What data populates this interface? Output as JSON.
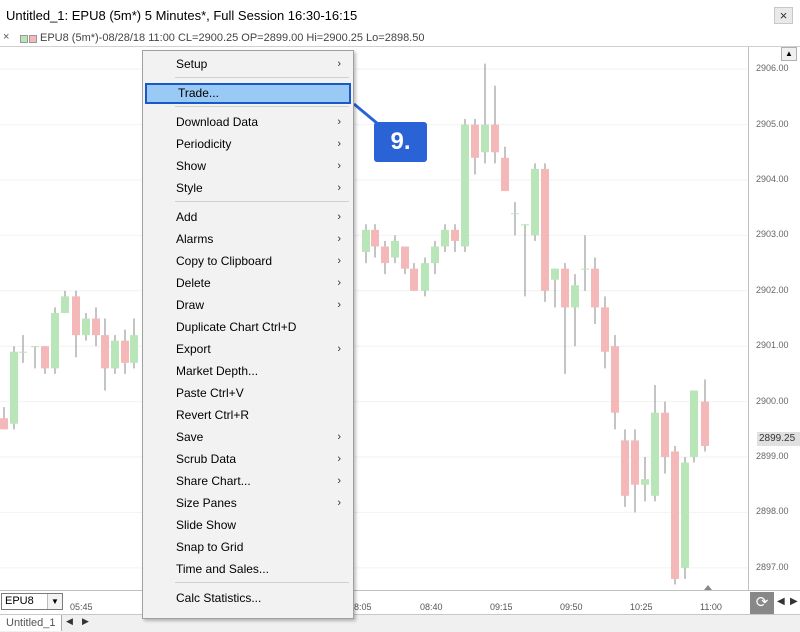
{
  "window": {
    "title": "Untitled_1: EPU8 (5m*) 5 Minutes*, Full Session 16:30-16:15",
    "close_glyph": "×"
  },
  "infobar": {
    "text": "EPU8 (5m*)-08/28/18 11:00 CL=2900.25 OP=2899.00 Hi=2900.25 Lo=2898.50",
    "close_glyph": "×"
  },
  "yaxis": {
    "ticks": [
      "2906.00",
      "2905.00",
      "2904.00",
      "2903.00",
      "2902.00",
      "2901.00",
      "2900.00",
      "2899.00",
      "2898.00",
      "2897.00"
    ],
    "current_price": "2899.25"
  },
  "xaxis": {
    "ticks": [
      "05:45",
      "8:05",
      "08:40",
      "09:15",
      "09:50",
      "10:25",
      "11:00"
    ]
  },
  "symbol": {
    "value": "EPU8"
  },
  "tab": {
    "label": "Untitled_1"
  },
  "colors": {
    "up": "#b8e6b8",
    "down": "#f4b8b8",
    "highlight": "#99c9f5",
    "callout": "#2a63d6"
  },
  "menu": {
    "items": [
      {
        "label": "Setup",
        "submenu": true
      },
      {
        "label": "Trade...",
        "submenu": false,
        "highlighted": true
      },
      {
        "label": "Download Data",
        "submenu": true
      },
      {
        "label": "Periodicity",
        "submenu": true
      },
      {
        "label": "Show",
        "submenu": true
      },
      {
        "label": "Style",
        "submenu": true
      },
      {
        "label": "Add",
        "submenu": true
      },
      {
        "label": "Alarms",
        "submenu": true
      },
      {
        "label": "Copy to Clipboard",
        "submenu": true
      },
      {
        "label": "Delete",
        "submenu": true
      },
      {
        "label": "Draw",
        "submenu": true
      },
      {
        "label": "Duplicate Chart  Ctrl+D",
        "submenu": false
      },
      {
        "label": "Export",
        "submenu": true
      },
      {
        "label": "Market Depth...",
        "submenu": false
      },
      {
        "label": "Paste  Ctrl+V",
        "submenu": false
      },
      {
        "label": "Revert  Ctrl+R",
        "submenu": false
      },
      {
        "label": "Save",
        "submenu": true
      },
      {
        "label": "Scrub Data",
        "submenu": true
      },
      {
        "label": "Share Chart...",
        "submenu": true
      },
      {
        "label": "Size Panes",
        "submenu": true
      },
      {
        "label": "Slide Show",
        "submenu": false
      },
      {
        "label": "Snap to Grid",
        "submenu": false
      },
      {
        "label": "Time and Sales...",
        "submenu": false
      },
      {
        "label": "Calc Statistics...",
        "submenu": false
      }
    ],
    "arrow_glyph": "›"
  },
  "callout": {
    "label": "9."
  },
  "chart_data": {
    "type": "candlestick",
    "ylim": [
      2896.6,
      2906.4
    ],
    "candles": [
      {
        "x": 4,
        "o": 2899.7,
        "h": 2899.9,
        "c": 2899.5,
        "l": 2899.5
      },
      {
        "x": 14,
        "o": 2899.6,
        "h": 2901.0,
        "c": 2900.9,
        "l": 2899.5
      },
      {
        "x": 23,
        "o": 2900.9,
        "h": 2901.2,
        "c": 2900.9,
        "l": 2900.7
      },
      {
        "x": 35,
        "o": 2901.0,
        "h": 2901.0,
        "c": 2901.0,
        "l": 2900.6
      },
      {
        "x": 45,
        "o": 2901.0,
        "h": 2901.0,
        "c": 2900.6,
        "l": 2900.5
      },
      {
        "x": 55,
        "o": 2900.6,
        "h": 2901.7,
        "c": 2901.6,
        "l": 2900.5
      },
      {
        "x": 65,
        "o": 2901.6,
        "h": 2902.0,
        "c": 2901.9,
        "l": 2901.6
      },
      {
        "x": 76,
        "o": 2901.9,
        "h": 2902.0,
        "c": 2901.2,
        "l": 2900.8
      },
      {
        "x": 86,
        "o": 2901.2,
        "h": 2901.6,
        "c": 2901.5,
        "l": 2901.1
      },
      {
        "x": 96,
        "o": 2901.5,
        "h": 2901.7,
        "c": 2901.2,
        "l": 2901.0
      },
      {
        "x": 105,
        "o": 2901.2,
        "h": 2901.5,
        "c": 2900.6,
        "l": 2900.2
      },
      {
        "x": 115,
        "o": 2900.6,
        "h": 2901.2,
        "c": 2901.1,
        "l": 2900.5
      },
      {
        "x": 125,
        "o": 2901.1,
        "h": 2901.3,
        "c": 2900.7,
        "l": 2900.5
      },
      {
        "x": 134,
        "o": 2900.7,
        "h": 2901.5,
        "c": 2901.2,
        "l": 2900.6
      },
      {
        "x": 366,
        "o": 2902.7,
        "h": 2903.2,
        "c": 2903.1,
        "l": 2902.5
      },
      {
        "x": 375,
        "o": 2903.1,
        "h": 2903.2,
        "c": 2902.8,
        "l": 2902.6
      },
      {
        "x": 385,
        "o": 2902.8,
        "h": 2902.9,
        "c": 2902.5,
        "l": 2902.3
      },
      {
        "x": 395,
        "o": 2902.6,
        "h": 2903.0,
        "c": 2902.9,
        "l": 2902.5
      },
      {
        "x": 405,
        "o": 2902.8,
        "h": 2902.8,
        "c": 2902.4,
        "l": 2902.3
      },
      {
        "x": 414,
        "o": 2902.4,
        "h": 2902.5,
        "c": 2902.0,
        "l": 2902.0
      },
      {
        "x": 425,
        "o": 2902.0,
        "h": 2902.6,
        "c": 2902.5,
        "l": 2901.9
      },
      {
        "x": 435,
        "o": 2902.5,
        "h": 2902.9,
        "c": 2902.8,
        "l": 2902.3
      },
      {
        "x": 445,
        "o": 2902.8,
        "h": 2903.2,
        "c": 2903.1,
        "l": 2902.7
      },
      {
        "x": 455,
        "o": 2903.1,
        "h": 2903.2,
        "c": 2902.9,
        "l": 2902.7
      },
      {
        "x": 465,
        "o": 2902.8,
        "h": 2905.1,
        "c": 2905.0,
        "l": 2902.7
      },
      {
        "x": 475,
        "o": 2905.0,
        "h": 2905.1,
        "c": 2904.4,
        "l": 2904.1
      },
      {
        "x": 485,
        "o": 2904.5,
        "h": 2906.1,
        "c": 2905.0,
        "l": 2904.3
      },
      {
        "x": 495,
        "o": 2905.0,
        "h": 2905.7,
        "c": 2904.5,
        "l": 2904.3
      },
      {
        "x": 505,
        "o": 2904.4,
        "h": 2904.6,
        "c": 2903.8,
        "l": 2903.8
      },
      {
        "x": 515,
        "o": 2903.4,
        "h": 2903.6,
        "c": 2903.4,
        "l": 2903.0
      },
      {
        "x": 525,
        "o": 2903.2,
        "h": 2903.2,
        "c": 2903.2,
        "l": 2901.9
      },
      {
        "x": 535,
        "o": 2903.0,
        "h": 2904.3,
        "c": 2904.2,
        "l": 2902.9
      },
      {
        "x": 545,
        "o": 2904.2,
        "h": 2904.3,
        "c": 2902.0,
        "l": 2901.8
      },
      {
        "x": 555,
        "o": 2902.2,
        "h": 2902.4,
        "c": 2902.4,
        "l": 2901.7
      },
      {
        "x": 565,
        "o": 2902.4,
        "h": 2902.5,
        "c": 2901.7,
        "l": 2900.5
      },
      {
        "x": 575,
        "o": 2901.7,
        "h": 2902.3,
        "c": 2902.1,
        "l": 2901.0
      },
      {
        "x": 585,
        "o": 2902.4,
        "h": 2903.0,
        "c": 2902.4,
        "l": 2902.0
      },
      {
        "x": 595,
        "o": 2902.4,
        "h": 2902.6,
        "c": 2901.7,
        "l": 2901.4
      },
      {
        "x": 605,
        "o": 2901.7,
        "h": 2901.9,
        "c": 2900.9,
        "l": 2900.6
      },
      {
        "x": 615,
        "o": 2901.0,
        "h": 2901.2,
        "c": 2899.8,
        "l": 2899.5
      },
      {
        "x": 625,
        "o": 2899.3,
        "h": 2899.5,
        "c": 2898.3,
        "l": 2898.1
      },
      {
        "x": 635,
        "o": 2899.3,
        "h": 2899.5,
        "c": 2898.5,
        "l": 2898.0
      },
      {
        "x": 645,
        "o": 2898.5,
        "h": 2899.0,
        "c": 2898.6,
        "l": 2898.2
      },
      {
        "x": 655,
        "o": 2898.3,
        "h": 2900.3,
        "c": 2899.8,
        "l": 2898.2
      },
      {
        "x": 665,
        "o": 2899.8,
        "h": 2900.0,
        "c": 2899.0,
        "l": 2898.7
      },
      {
        "x": 675,
        "o": 2899.1,
        "h": 2899.2,
        "c": 2896.8,
        "l": 2896.7
      },
      {
        "x": 685,
        "o": 2897.0,
        "h": 2899.0,
        "c": 2898.9,
        "l": 2896.8
      },
      {
        "x": 694,
        "o": 2899.0,
        "h": 2900.2,
        "c": 2900.2,
        "l": 2898.9
      },
      {
        "x": 705,
        "o": 2900.0,
        "h": 2900.4,
        "c": 2899.2,
        "l": 2899.1
      }
    ]
  }
}
